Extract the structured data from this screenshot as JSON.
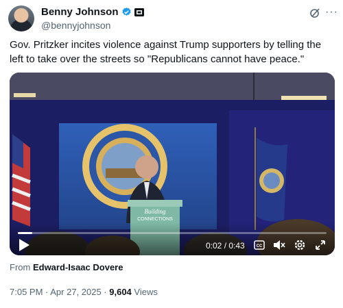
{
  "author": {
    "name": "Benny Johnson",
    "handle": "@bennyjohnson",
    "avatar_icon": "avatar",
    "verified_icon": "verified-badge-icon",
    "affiliation_icon": "affiliation-badge-icon"
  },
  "actions": {
    "grok_icon": "grok-icon",
    "more_label": "···"
  },
  "tweet": {
    "text": "Gov. Pritzker incites violence against Trump supporters by telling the left to take over the streets so \"Republicans cannot have peace.\""
  },
  "video": {
    "time": "0:02 / 0:43",
    "progress": 0.046,
    "podium_text": "Building\nCONNECTIONS",
    "colors": {
      "stage_blue": "#1b1d5a",
      "banner_blue": "#2b57a6",
      "podium_green": "#6aa592"
    }
  },
  "source": {
    "prefix": "From ",
    "name": "Edward-Isaac Dovere"
  },
  "meta": {
    "timestamp": "7:05 PM · Apr 27, 2025 · ",
    "views_count": "9,604",
    "views_label": " Views"
  },
  "colors": {
    "text": "#0f1419",
    "secondary": "#536471",
    "verified": "#1d9bf0"
  }
}
